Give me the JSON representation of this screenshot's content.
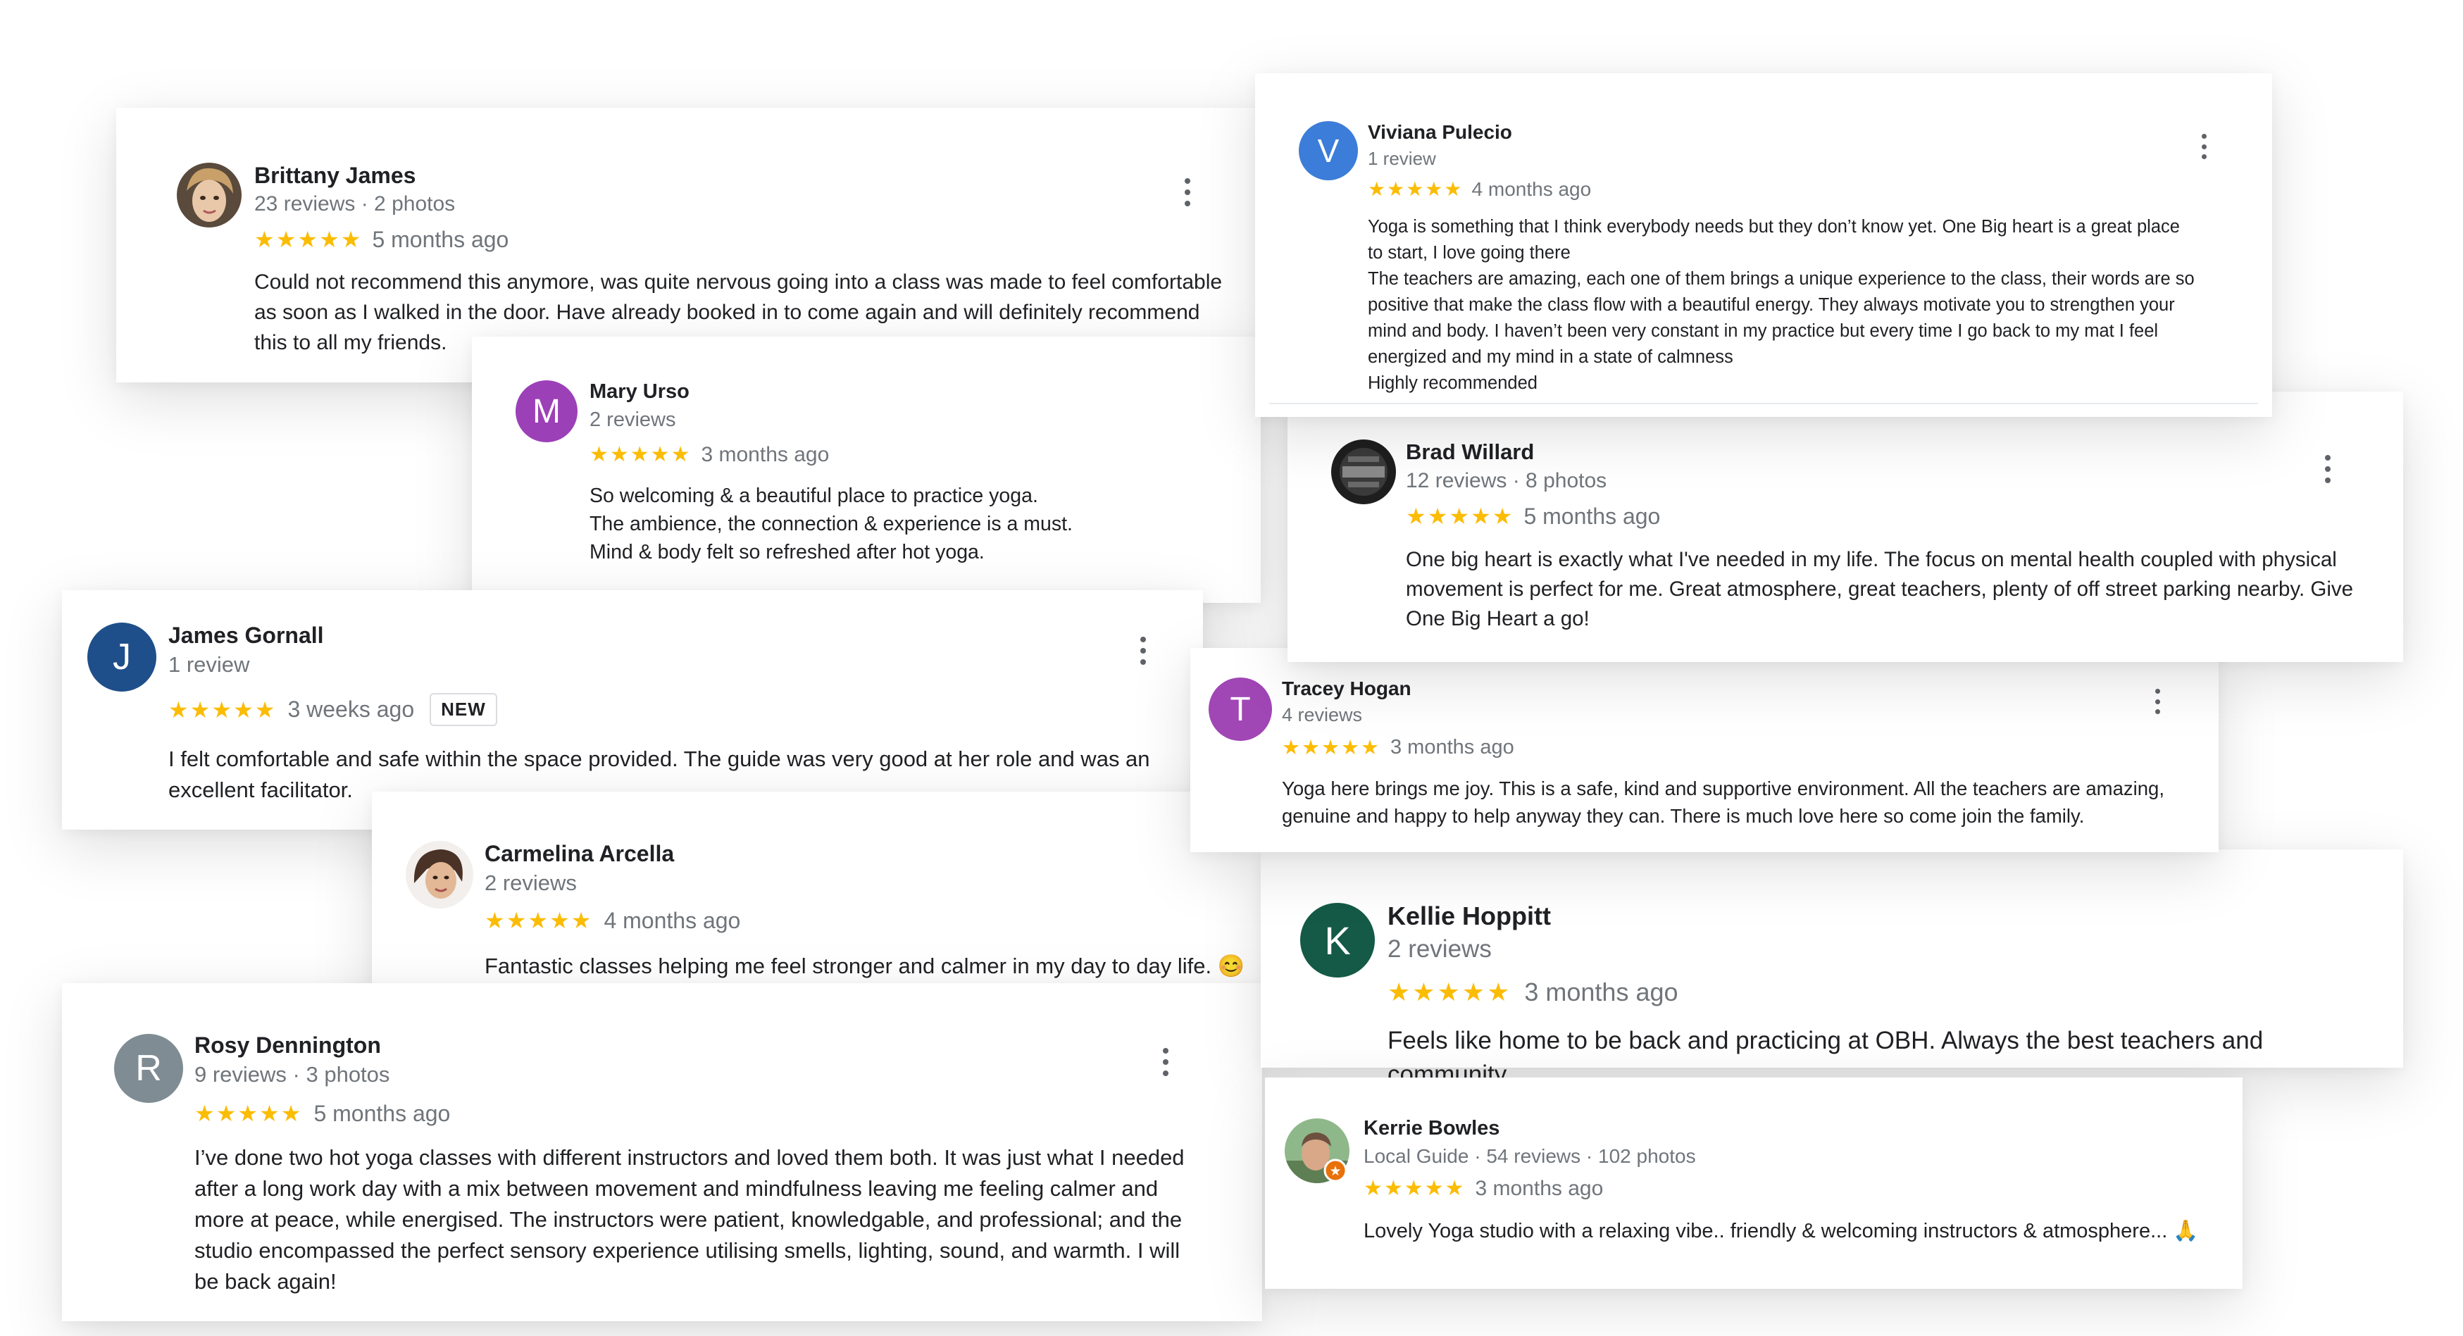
{
  "stars_glyph": "★★★★★",
  "colors": {
    "star": "#fbbc04",
    "meta_text": "#70757a",
    "avatar_viviana": "#3b7dd8",
    "avatar_mary": "#9c40b8",
    "avatar_james": "#1e4f8a",
    "avatar_tracey": "#a046b5",
    "avatar_kellie": "#145a46",
    "avatar_rosy": "#7f8c93"
  },
  "reviews": {
    "viviana": {
      "initial": "V",
      "name": "Viviana Pulecio",
      "meta": "1 review",
      "time": "4 months ago",
      "text": "Yoga is something that I think everybody needs but they don’t know yet. One Big heart is a great place\nto start, I love going there\nThe teachers are amazing, each one of them brings a unique experience to the class, their words are so\npositive that make the class flow with a beautiful energy. They always motivate you to strengthen your\nmind and body. I haven’t been very constant in my practice but every time I go back to my mat I feel\nenergized and my mind in a state of calmness\nHighly  recommended"
    },
    "brittany": {
      "name": "Brittany James",
      "meta": "23 reviews · 2 photos",
      "time": "5 months ago",
      "text": "Could not recommend this anymore, was quite nervous going into a class was made to feel comfortable\nas soon as I walked in the door. Have already booked in to come again and will definitely recommend\nthis to all my friends."
    },
    "brad": {
      "name": "Brad Willard",
      "meta": "12 reviews · 8 photos",
      "time": "5 months ago",
      "text": "One big heart is exactly what I've needed in my life. The focus on mental health coupled with physical\nmovement is perfect for me. Great atmosphere, great teachers, plenty of off street parking nearby. Give\nOne Big Heart a go!"
    },
    "mary": {
      "initial": "M",
      "name": "Mary Urso",
      "meta": "2 reviews",
      "time": "3 months ago",
      "text": "So welcoming & a beautiful place to practice yoga.\nThe ambience, the connection & experience is a must.\nMind & body felt so refreshed after hot yoga."
    },
    "tracey": {
      "initial": "T",
      "name": "Tracey Hogan",
      "meta": "4 reviews",
      "time": "3 months ago",
      "text": "Yoga here brings me joy. This is a safe, kind and supportive environment. All the teachers are amazing,\ngenuine and happy to help anyway they can. There is much love here so come join the family."
    },
    "james": {
      "initial": "J",
      "name": "James Gornall",
      "meta": "1 review",
      "time": "3 weeks ago",
      "badge": "NEW",
      "text": "I felt comfortable and safe within the space provided. The guide was very good at her role and was an\nexcellent facilitator."
    },
    "carmelina": {
      "name": "Carmelina Arcella",
      "meta": "2 reviews",
      "time": "4 months ago",
      "text": "Fantastic classes helping me feel stronger and calmer in my day to day life. 😊"
    },
    "kellie": {
      "initial": "K",
      "name": "Kellie Hoppitt",
      "meta": "2 reviews",
      "time": "3 months ago",
      "text": "Feels like home to be back and practicing at OBH. Always the best teachers and community."
    },
    "rosy": {
      "initial": "R",
      "name": "Rosy Dennington",
      "meta": "9 reviews · 3 photos",
      "time": "5 months ago",
      "text": "I’ve done two hot yoga classes with different instructors and loved them both. It was just what I needed\nafter a long work day with a mix between movement and mindfulness leaving me feeling calmer and\nmore at peace, while energised. The instructors were patient, knowledgable, and professional; and the\nstudio encompassed the perfect sensory experience utilising smells, lighting, sound, and warmth. I will\nbe back again!"
    },
    "kerrie": {
      "name": "Kerrie Bowles",
      "meta": "Local Guide · 54 reviews · 102 photos",
      "time": "3 months ago",
      "text": "Lovely Yoga studio with a relaxing vibe.. friendly & welcoming instructors & atmosphere... 🙏"
    }
  }
}
